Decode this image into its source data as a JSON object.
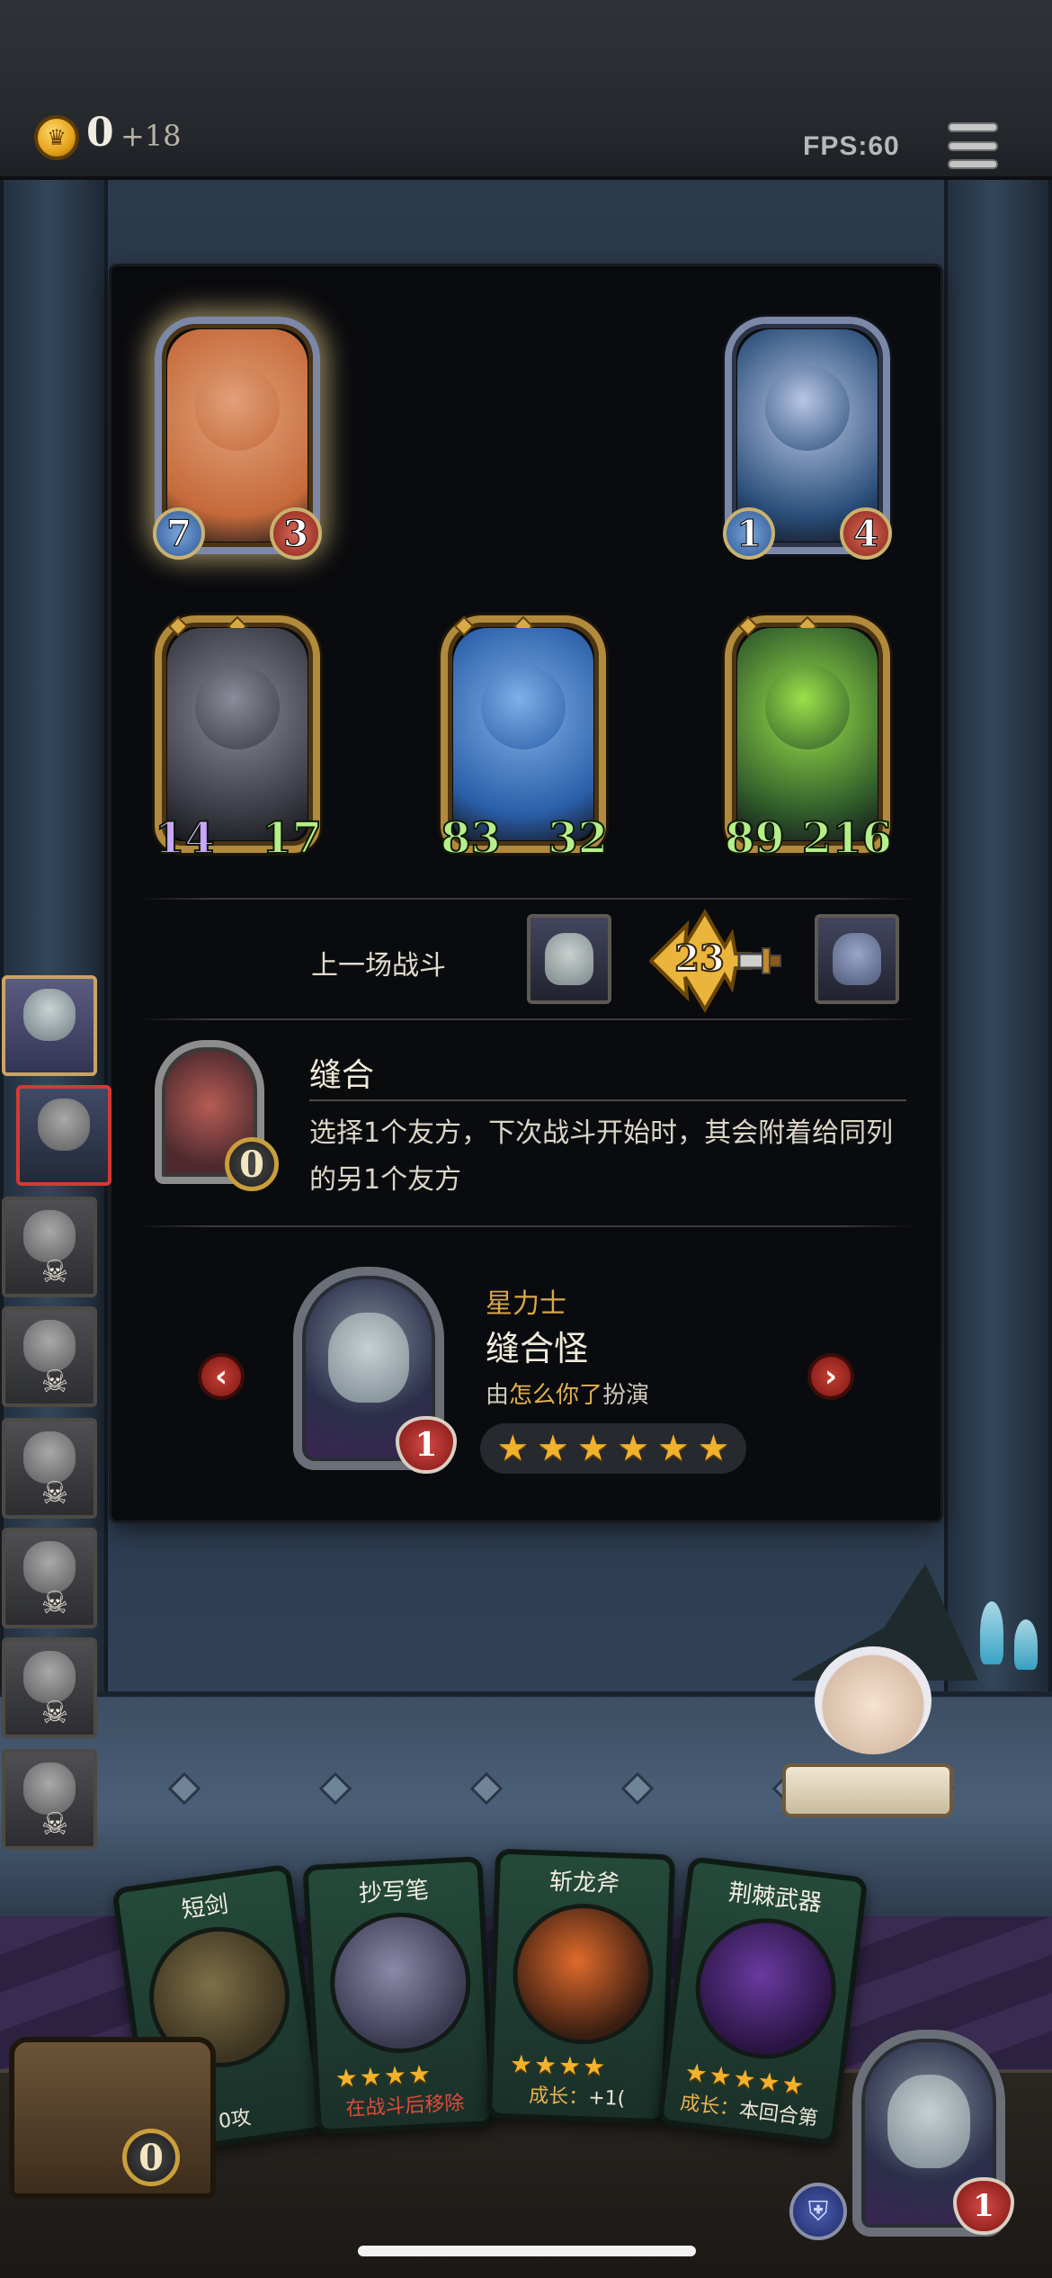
{
  "hud": {
    "gold": "0",
    "gold_income": "+18",
    "fps": "FPS:60",
    "coin_icon": "crown-coin-icon",
    "menu_icon": "hamburger-menu-icon"
  },
  "board": {
    "top_row": [
      {
        "attack": "7",
        "health": "3",
        "selected": true,
        "style": "silver",
        "art_colors": [
          "#c56a3a",
          "#e2a07a"
        ]
      },
      {
        "attack": "1",
        "health": "4",
        "selected": false,
        "style": "silver",
        "art_colors": [
          "#2a4e7a",
          "#b8c6e4"
        ]
      }
    ],
    "bottom_row": [
      {
        "attack": "14",
        "health": "17",
        "style": "gold",
        "art_colors": [
          "#3a3a44",
          "#8b8b99"
        ]
      },
      {
        "attack": "83",
        "health": "32",
        "style": "gold",
        "art_colors": [
          "#2a5ea8",
          "#7fb0e8"
        ]
      },
      {
        "attack": "89",
        "health": "216",
        "style": "gold",
        "art_colors": [
          "#2f5a2a",
          "#9be04a"
        ]
      }
    ]
  },
  "last_battle": {
    "label": "上一场战斗",
    "damage": "23"
  },
  "spell": {
    "name": "缝合",
    "cost": "0",
    "description": "选择1个友方，下次战斗开始时，其会附着给同列的另1个友方"
  },
  "hero": {
    "class_label": "星力士",
    "name": "缝合怪",
    "credit_prefix": "由",
    "credit_player": "怎么你了",
    "credit_suffix": "扮演",
    "level": "1",
    "stars": 6
  },
  "navigation": {
    "prev_label": "‹",
    "next_label": "›"
  },
  "opponents": [
    {
      "state": "active",
      "skull": false
    },
    {
      "state": "next",
      "skull": false
    },
    {
      "state": "dead",
      "skull": true
    },
    {
      "state": "dead",
      "skull": true
    },
    {
      "state": "dead",
      "skull": true
    },
    {
      "state": "dead",
      "skull": true
    },
    {
      "state": "dead",
      "skull": true
    },
    {
      "state": "dead",
      "skull": true
    }
  ],
  "shop": {
    "cards": [
      {
        "title": "短剑",
        "stars": "★★",
        "desc_parts": [
          {
            "text": "0攻",
            "color": ""
          }
        ]
      },
      {
        "title": "抄写笔",
        "stars": "★★★★",
        "desc_parts": [
          {
            "text": "在战斗后移除",
            "color": "red"
          }
        ]
      },
      {
        "title": "斩龙斧",
        "stars": "★★★★",
        "desc_parts": [
          {
            "text": "成长：",
            "color": "gold"
          },
          {
            "text": "+1(",
            "color": ""
          }
        ]
      },
      {
        "title": "荆棘武器",
        "stars": "★★★★★",
        "desc_parts": [
          {
            "text": "成长：",
            "color": "gold"
          },
          {
            "text": "本回合第",
            "color": ""
          }
        ]
      }
    ],
    "chest_count": "0"
  },
  "player": {
    "level": "1"
  },
  "icons": {
    "skull": "skull-icon",
    "shield": "shield-icon",
    "sword": "sword-icon"
  }
}
